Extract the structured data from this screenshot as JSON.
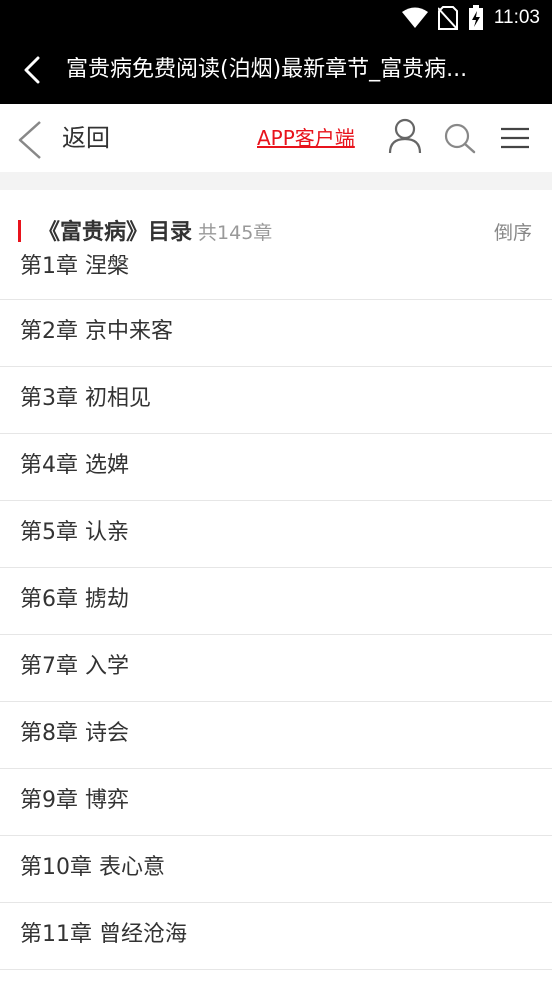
{
  "status_bar": {
    "time": "11:03",
    "icons": [
      "wifi-icon",
      "no-sim-icon",
      "battery-charging-icon"
    ]
  },
  "title_bar": {
    "title": "富贵病免费阅读(泊烟)最新章节_富贵病..."
  },
  "nav": {
    "back_label": "返回",
    "app_link": "APP客户端",
    "icons": [
      "user-icon",
      "search-icon",
      "menu-icon"
    ]
  },
  "catalog": {
    "title": "《富贵病》目录",
    "count": "共145章",
    "reverse_label": "倒序"
  },
  "chapters": [
    "第1章 涅槃",
    "第2章 京中来客",
    "第3章 初相见",
    "第4章 选婢",
    "第5章 认亲",
    "第6章 掳劫",
    "第7章 入学",
    "第8章 诗会",
    "第9章 博弈",
    "第10章 表心意",
    "第11章 曾经沧海"
  ],
  "colors": {
    "accent": "#e8131c",
    "header_bg": "#000000",
    "band": "#f3f3f3"
  }
}
